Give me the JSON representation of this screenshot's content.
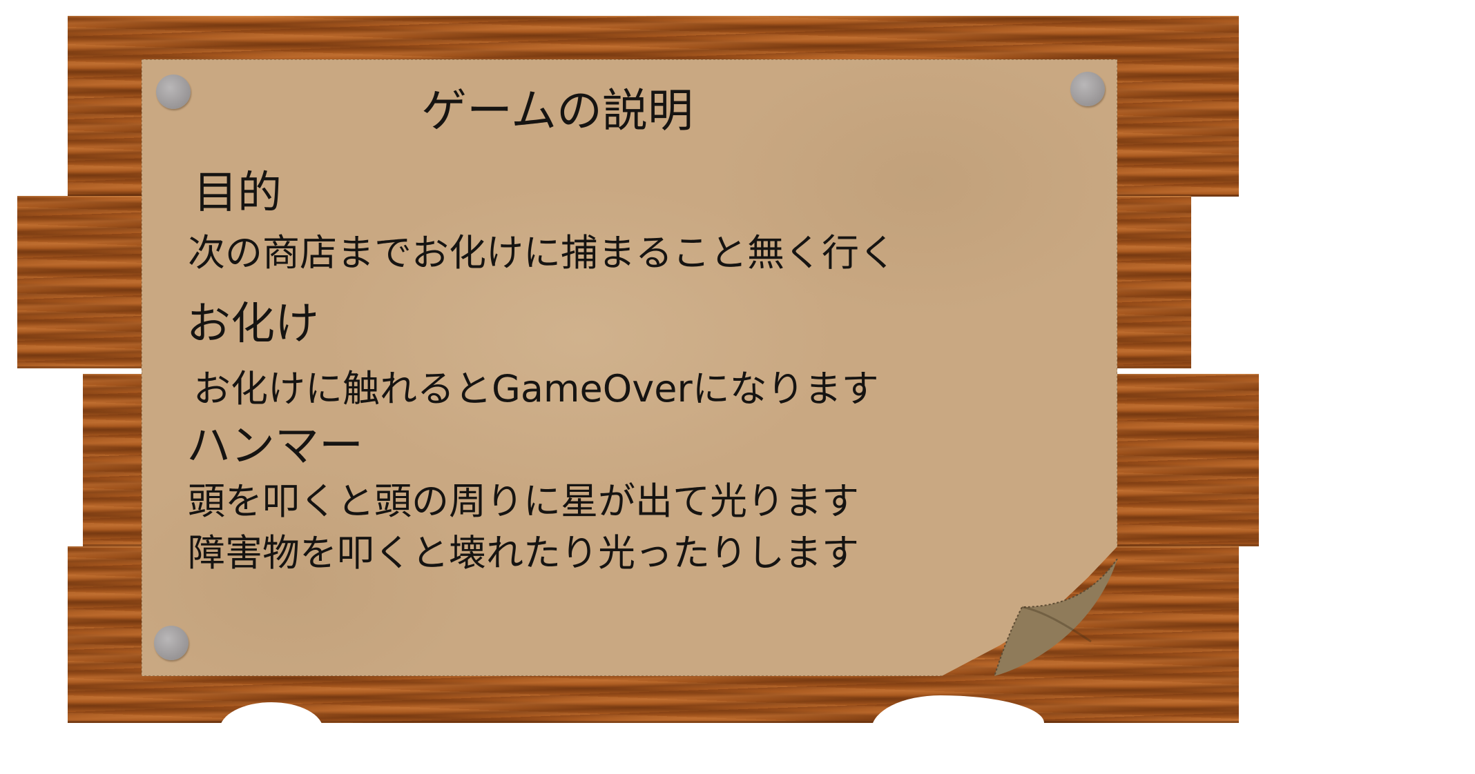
{
  "sign": {
    "title": "ゲームの説明",
    "sections": [
      {
        "heading": "目的",
        "lines": [
          "次の商店までお化けに捕まること無く行く"
        ]
      },
      {
        "heading": "お化け",
        "lines": [
          "お化けに触れるとGameOverになります"
        ]
      },
      {
        "heading": "ハンマー",
        "lines": [
          "頭を叩くと頭の周りに星が出て光ります",
          "障害物を叩くと壊れたり光ったりします"
        ]
      }
    ]
  },
  "colors": {
    "wood": "#a8581e",
    "paper": "#c9a882",
    "pin": "#9d9a9b",
    "text": "#161412"
  }
}
